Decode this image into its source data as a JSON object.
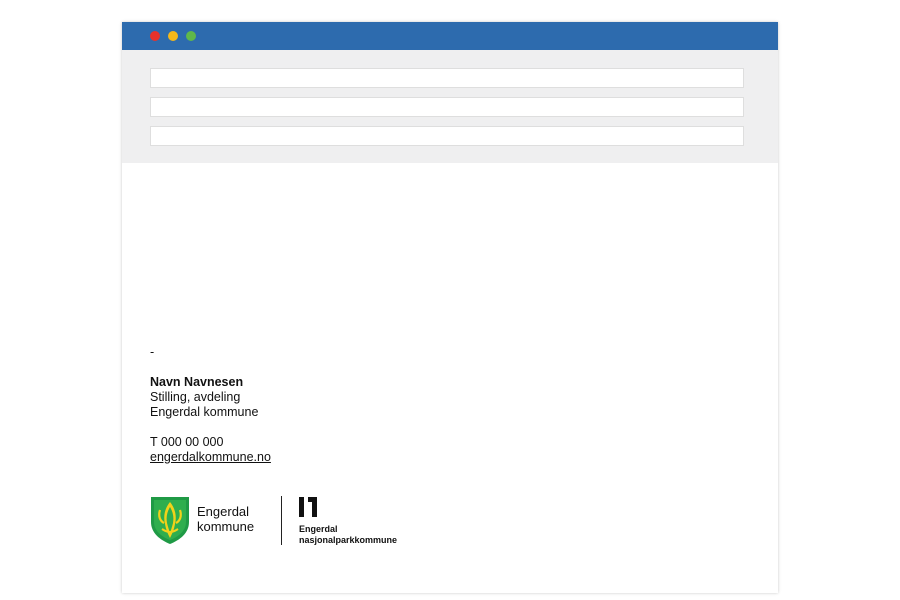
{
  "window": {
    "controls": [
      "close",
      "minimize",
      "maximize"
    ],
    "colors": {
      "titlebar": "#2d6bae",
      "close": "#e8322a",
      "minimize": "#f5b81a",
      "maximize": "#5fb84a"
    }
  },
  "header_fields": [
    {
      "value": ""
    },
    {
      "value": ""
    },
    {
      "value": ""
    }
  ],
  "signature": {
    "separator": "-",
    "name": "Navn Navnesen",
    "title": "Stilling, avdeling",
    "organization": "Engerdal kommune",
    "phone": "T 000 00 000",
    "website": "engerdalkommune.no"
  },
  "logos": {
    "municipality_line1": "Engerdal",
    "municipality_line2": "kommune",
    "park_line1": "Engerdal",
    "park_line2": "nasjonalparkkommune",
    "shield_icon": "coat-of-arms-icon",
    "park_icon": "nasjonalpark-icon"
  }
}
